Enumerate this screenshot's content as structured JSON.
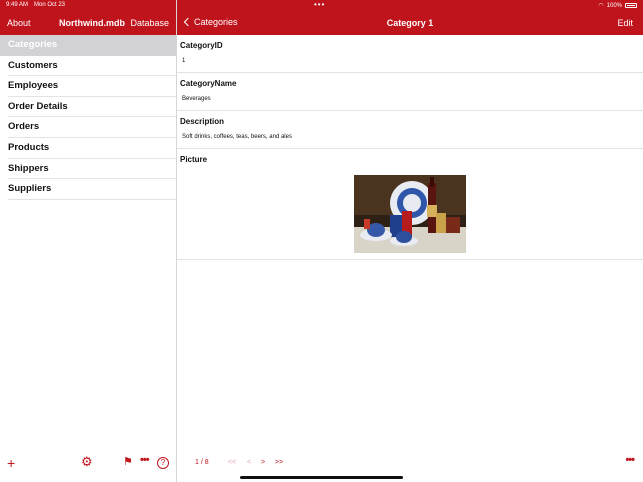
{
  "status_bar": {
    "time": "9:49 AM",
    "date": "Mon Oct 23",
    "battery": "100%"
  },
  "left_nav": {
    "about": "About",
    "title": "Northwind.mdb",
    "database": "Database"
  },
  "right_nav": {
    "back": "Categories",
    "title": "Category 1",
    "edit": "Edit"
  },
  "sidebar": {
    "items": [
      {
        "label": "Categories",
        "selected": true
      },
      {
        "label": "Customers"
      },
      {
        "label": "Employees"
      },
      {
        "label": "Order Details"
      },
      {
        "label": "Orders"
      },
      {
        "label": "Products"
      },
      {
        "label": "Shippers"
      },
      {
        "label": "Suppliers"
      }
    ]
  },
  "record": {
    "fields": [
      {
        "label": "CategoryID",
        "value": "1"
      },
      {
        "label": "CategoryName",
        "value": "Beverages"
      },
      {
        "label": "Description",
        "value": "Soft drinks, coffees, teas, beers, and ales"
      }
    ],
    "picture_label": "Picture"
  },
  "pager": {
    "count": "1 / 8",
    "first": "<<",
    "prev": "<",
    "next": ">",
    "last": ">>"
  },
  "colors": {
    "accent": "#c0141d",
    "selection": "#d1d1d6"
  },
  "icons": {
    "add": "plus-icon",
    "settings": "gear-icon",
    "flag": "flag-icon",
    "more": "ellipsis-icon",
    "help": "help-icon"
  }
}
